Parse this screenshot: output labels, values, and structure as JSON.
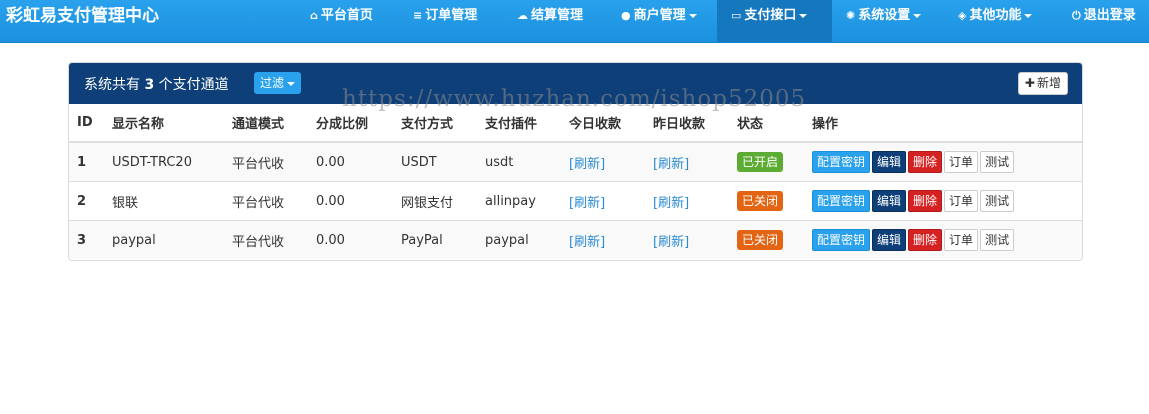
{
  "app": {
    "title": "彩虹易支付管理中心"
  },
  "nav": [
    {
      "label": "平台首页",
      "icon": "home-icon",
      "glyph": "⌂"
    },
    {
      "label": "订单管理",
      "icon": "list-icon",
      "glyph": "≡"
    },
    {
      "label": "结算管理",
      "icon": "cloud-icon",
      "glyph": "☁"
    },
    {
      "label": "商户管理",
      "icon": "user-icon",
      "glyph": "●"
    },
    {
      "label": "支付接口",
      "icon": "credit-card-icon",
      "glyph": "▭"
    },
    {
      "label": "系统设置",
      "icon": "gear-icon",
      "glyph": "✺"
    },
    {
      "label": "其他功能",
      "icon": "cube-icon",
      "glyph": "◈"
    },
    {
      "label": "退出登录",
      "icon": "power-icon",
      "glyph": "⏻"
    }
  ],
  "panel": {
    "title_prefix": "系统共有",
    "count": "3",
    "title_suffix": "个支付通道",
    "filter_label": "过滤",
    "add_label": "新增"
  },
  "watermark": "https://www.huzhan.com/ishop52005",
  "table": {
    "headers": [
      "ID",
      "显示名称",
      "通道模式",
      "分成比例",
      "支付方式",
      "支付插件",
      "今日收款",
      "昨日收款",
      "状态",
      "操作"
    ],
    "rows": [
      {
        "id": "1",
        "name": "USDT-TRC20",
        "mode": "平台代收",
        "ratio": "0.00",
        "method": "USDT",
        "plugin": "usdt",
        "today": "[刷新]",
        "yesterday": "[刷新]",
        "status": "已开启",
        "status_type": "on"
      },
      {
        "id": "2",
        "name": "银联",
        "mode": "平台代收",
        "ratio": "0.00",
        "method": "网银支付",
        "plugin": "allinpay",
        "today": "[刷新]",
        "yesterday": "[刷新]",
        "status": "已关闭",
        "status_type": "off"
      },
      {
        "id": "3",
        "name": "paypal",
        "mode": "平台代收",
        "ratio": "0.00",
        "method": "PayPal",
        "plugin": "paypal",
        "today": "[刷新]",
        "yesterday": "[刷新]",
        "status": "已关闭",
        "status_type": "off"
      }
    ],
    "actions": {
      "key": "配置密钥",
      "edit": "编辑",
      "delete": "删除",
      "orders": "订单",
      "test": "测试"
    }
  }
}
